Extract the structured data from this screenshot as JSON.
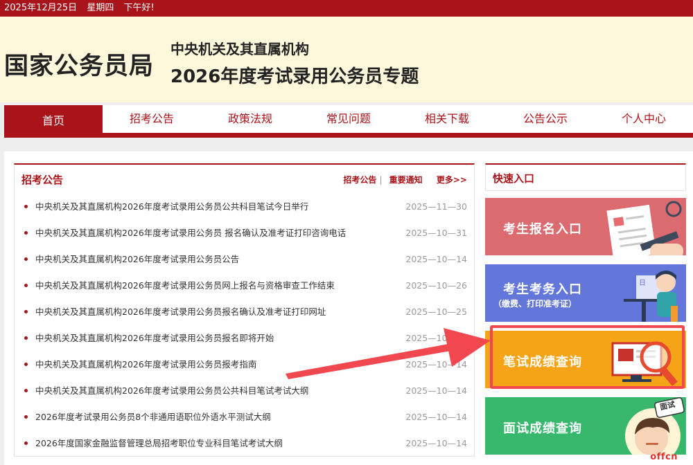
{
  "topbar": {
    "date": "2025年12月25日",
    "weekday": "星期四",
    "greeting": "下午好!"
  },
  "header": {
    "logo": "国家公务员局",
    "subtitle1": "中央机关及其直属机构",
    "subtitle2": "2026年度考试录用公务员专题"
  },
  "nav": {
    "items": [
      "首页",
      "招考公告",
      "政策法规",
      "常见问题",
      "相关下载",
      "公告公示",
      "个人中心"
    ],
    "active": 0
  },
  "announcements": {
    "title": "招考公告",
    "tab1": "招考公告",
    "separator": "|",
    "tab2": "重要通知",
    "more": "更多>>",
    "items": [
      {
        "text": "中央机关及其直属机构2026年度考试录用公务员公共科目笔试今日举行",
        "date": "2025—11—30"
      },
      {
        "text": "中央机关及其直属机构2026年度考试录用公务员 报名确认及准考证打印咨询电话",
        "date": "2025—10—31"
      },
      {
        "text": "中央机关及其直属机构2026年度考试录用公务员公告",
        "date": "2025—10—14"
      },
      {
        "text": "中央机关及其直属机构2026年度考试录用公务员网上报名与资格审查工作结束",
        "date": "2025—10—26"
      },
      {
        "text": "中央机关及其直属机构2026年度考试录用公务员报名确认及准考证打印网址",
        "date": "2025—10—25"
      },
      {
        "text": "中央机关及其直属机构2026年度考试录用公务员报名即将开始",
        "date": "2025—10—14"
      },
      {
        "text": "中央机关及其直属机构2026年度考试录用公务员报考指南",
        "date": "2025—10—14"
      },
      {
        "text": "中央机关及其直属机构2026年度考试录用公务员公共科目笔试考试大纲",
        "date": "2025—10—14"
      },
      {
        "text": "2026年度考试录用公务员8个非通用语职位外语水平测试大纲",
        "date": "2025—10—14"
      },
      {
        "text": "2026年度国家金融监督管理总局招考职位专业科目笔试考试大纲",
        "date": "2025—10—14"
      }
    ]
  },
  "quick": {
    "title": "快速入口",
    "btn1": "考生报名入口",
    "btn2": "考生考务入口",
    "btn2_sub": "（缴费、打印准考证）",
    "btn3": "笔试成绩查询",
    "btn4": "面试成绩查询",
    "badge4": "面试"
  },
  "watermark": "offcn",
  "colors": {
    "brand_red": "#a8141a",
    "header_bg": "#fdf7dc",
    "q1": "#db6b6f",
    "q2": "#6277d9",
    "q3": "#f5a418",
    "q4": "#37b86c",
    "annotation": "#f0484e"
  }
}
